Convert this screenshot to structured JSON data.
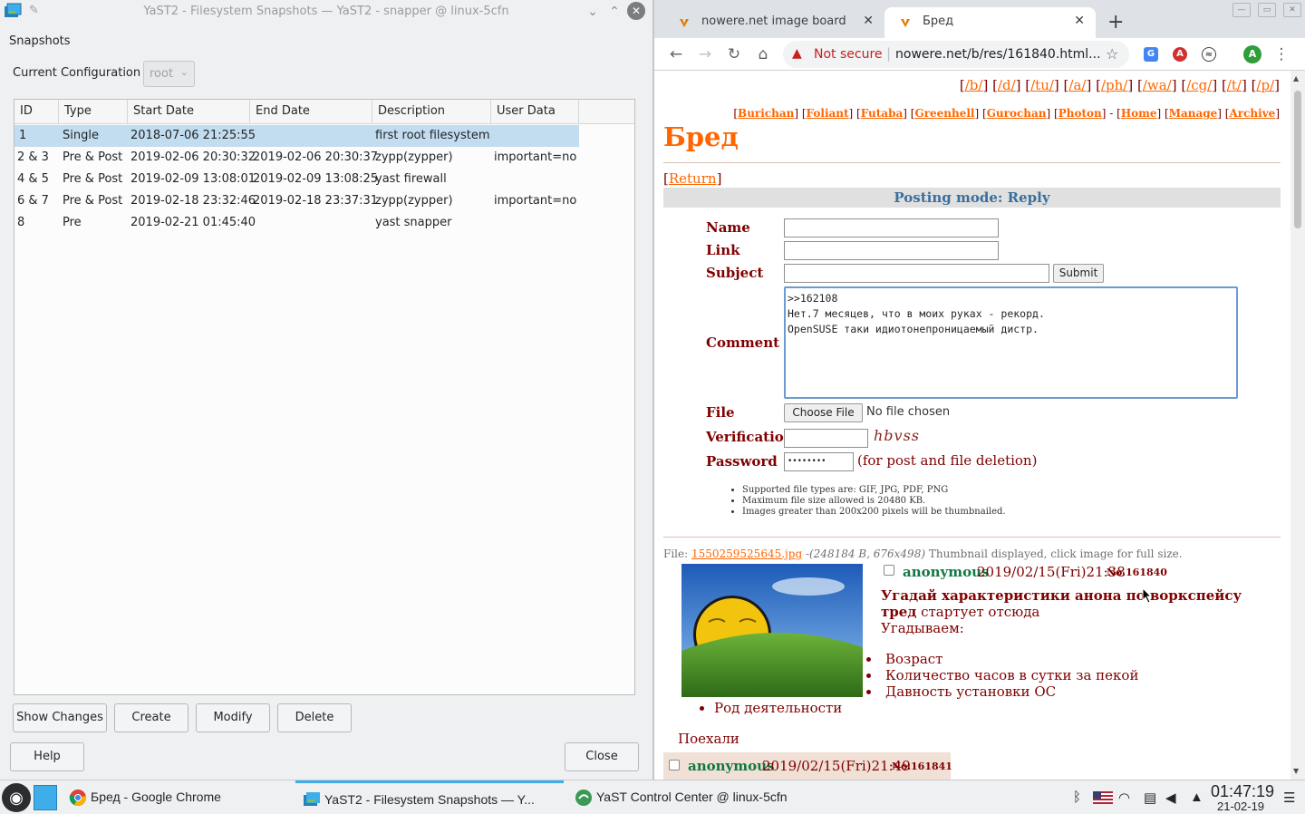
{
  "yast": {
    "title": "YaST2 - Filesystem Snapshots — YaST2 - snapper @ linux-5cfn",
    "heading": "Snapshots",
    "config_label": "Current Configuration",
    "config_value": "root",
    "columns": [
      "ID",
      "Type",
      "Start Date",
      "End Date",
      "Description",
      "User Data"
    ],
    "rows": [
      {
        "id": "1",
        "type": "Single",
        "start": "2018-07-06 21:25:55",
        "end": "",
        "desc": "first root filesystem",
        "user": ""
      },
      {
        "id": "2 & 3",
        "type": "Pre & Post",
        "start": "2019-02-06 20:30:32",
        "end": "2019-02-06 20:30:37",
        "desc": "zypp(zypper)",
        "user": "important=no"
      },
      {
        "id": "4 & 5",
        "type": "Pre & Post",
        "start": "2019-02-09 13:08:01",
        "end": "2019-02-09 13:08:25",
        "desc": "yast firewall",
        "user": ""
      },
      {
        "id": "6 & 7",
        "type": "Pre & Post",
        "start": "2019-02-18 23:32:46",
        "end": "2019-02-18 23:37:31",
        "desc": "zypp(zypper)",
        "user": "important=no"
      },
      {
        "id": "8",
        "type": "Pre",
        "start": "2019-02-21 01:45:40",
        "end": "",
        "desc": "yast snapper",
        "user": ""
      }
    ],
    "buttons": {
      "show_changes": "Show Changes",
      "create": "Create",
      "modify": "Modify",
      "delete": "Delete",
      "help": "Help",
      "close": "Close"
    }
  },
  "chrome": {
    "tabs": [
      {
        "label": "nowere.net image board"
      },
      {
        "label": "Бред"
      }
    ],
    "not_secure": "Not secure",
    "url": "nowere.net/b/res/161840.html...",
    "page": {
      "board_nav": [
        "/b/",
        "/d/",
        "/tu/",
        "/a/",
        "/ph/",
        "/wa/",
        "/cg/",
        "/t/",
        "/p/"
      ],
      "site_nav": [
        "Burichan",
        "Foliant",
        "Futaba",
        "Greenhell",
        "Gurochan",
        "Photon",
        "Home",
        "Manage",
        "Archive"
      ],
      "board_title": "Бред",
      "return": "Return",
      "posting_mode": "Posting mode: Reply",
      "labels": {
        "name": "Name",
        "link": "Link",
        "subject": "Subject",
        "comment": "Comment",
        "file": "File",
        "verification": "Verification",
        "password": "Password"
      },
      "submit": "Submit",
      "comment_text": ">>162108\nНет.7 месяцев, что в моих руках - рекорд.\nOpenSUSE таки идиотонепроницаемый дистр.",
      "choose_file": "Choose File",
      "no_file": "No file chosen",
      "captcha": "hbvss",
      "password_value": "••••••••",
      "password_hint": "(for post and file deletion)",
      "rules": [
        "Supported file types are: GIF, JPG, PDF, PNG",
        "Maximum file size allowed is 20480 KB.",
        "Images greater than 200x200 pixels will be thumbnailed."
      ],
      "file_prefix": "File: ",
      "file_name": "1550259525645.jpg",
      "file_meta": " -(248184 B, 676x498)",
      "file_note": " Thumbnail displayed, click image for full size.",
      "op": {
        "name": "anonymous",
        "date": "2019/02/15(Fri)21:38",
        "no": "No.161840",
        "bold_text": "Угадай характеристики анона по воркспейсу тред",
        "text_rest": " стартует отсюда",
        "line2": "Угадываем:",
        "list": [
          "Возраст",
          "Количество часов в сутки за пекой",
          "Давность установки ОС"
        ],
        "list2": "Род деятельности",
        "last": "Поехали"
      },
      "reply": {
        "name": "anonymous",
        "date": "2019/02/15(Fri)21:49",
        "no": "No.161841"
      }
    }
  },
  "taskbar": {
    "tasks": [
      {
        "label": "Бред - Google Chrome"
      },
      {
        "label": "YaST2 - Filesystem Snapshots — Y..."
      },
      {
        "label": "YaST Control Center @ linux-5cfn"
      }
    ],
    "time": "01:47:19",
    "date": "21-02-19"
  }
}
